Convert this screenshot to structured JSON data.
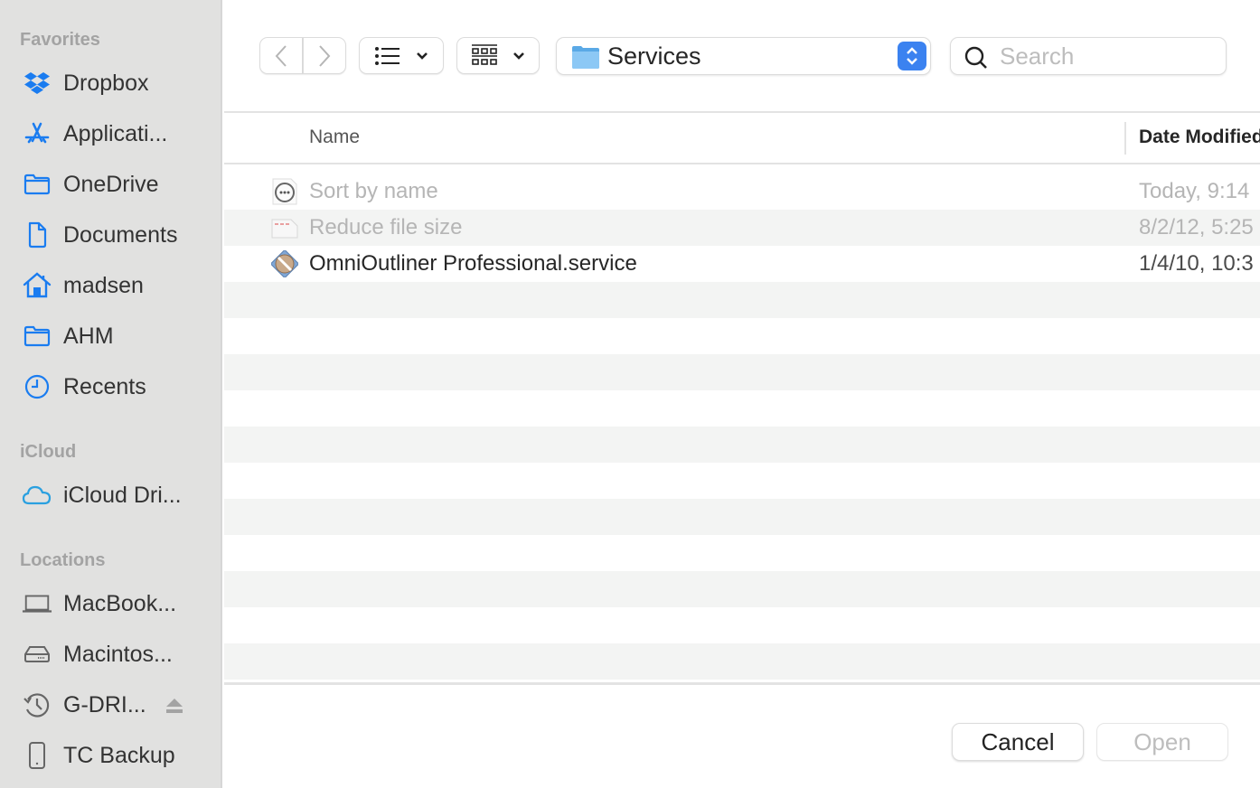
{
  "sidebar": {
    "sections": [
      {
        "title": "Favorites"
      },
      {
        "title": "iCloud"
      },
      {
        "title": "Locations"
      }
    ],
    "favorites": [
      {
        "label": "Dropbox",
        "icon": "dropbox-icon"
      },
      {
        "label": "Applicati...",
        "icon": "applications-icon"
      },
      {
        "label": "OneDrive",
        "icon": "folder-icon"
      },
      {
        "label": "Documents",
        "icon": "document-icon"
      },
      {
        "label": "madsen",
        "icon": "home-icon"
      },
      {
        "label": "AHM",
        "icon": "folder-icon"
      },
      {
        "label": "Recents",
        "icon": "clock-icon"
      }
    ],
    "icloud": [
      {
        "label": "iCloud Dri...",
        "icon": "cloud-icon"
      }
    ],
    "locations": [
      {
        "label": "MacBook...",
        "icon": "laptop-icon"
      },
      {
        "label": "Macintos...",
        "icon": "hard-drive-icon"
      },
      {
        "label": "G-DRI...",
        "icon": "time-machine-icon",
        "ejectable": true
      },
      {
        "label": "TC Backup",
        "icon": "external-drive-icon"
      }
    ]
  },
  "toolbar": {
    "back": "back",
    "forward": "forward",
    "view_mode": "list",
    "group_mode": "grid",
    "path": "Services",
    "search_placeholder": "Search",
    "search_value": ""
  },
  "table": {
    "columns": [
      "Name",
      "Date Modified"
    ],
    "rows": [
      {
        "name": "Sort by name",
        "date": "Today, 9:14",
        "enabled": false,
        "icon": "workflow-icon"
      },
      {
        "name": "Reduce file size",
        "date": "8/2/12, 5:25",
        "enabled": false,
        "icon": "filter-document-icon"
      },
      {
        "name": "OmniOutliner Professional.service",
        "date": "1/4/10, 10:3",
        "enabled": true,
        "icon": "omnioutliner-service-icon"
      }
    ],
    "empty_rows": 11
  },
  "footer": {
    "cancel": "Cancel",
    "open": "Open"
  },
  "colors": {
    "accent": "#3b82f0",
    "sidebar_icon": "#1a7cf0",
    "sidebar_bg": "#e1e1e0",
    "stripe": "#f3f4f3"
  }
}
